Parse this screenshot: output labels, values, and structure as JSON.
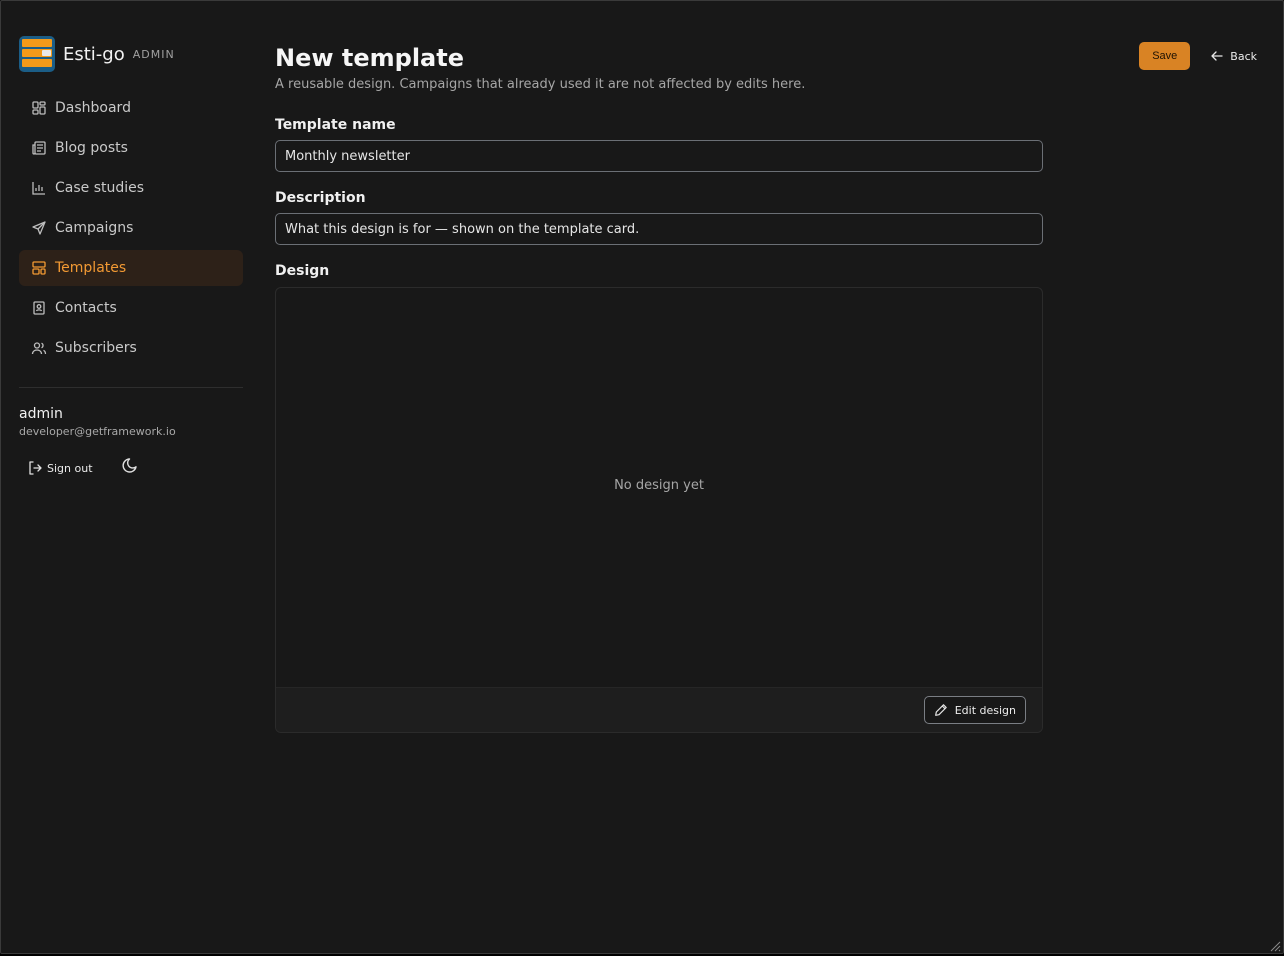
{
  "brand": {
    "name": "Esti-go",
    "tag": "ADMIN"
  },
  "nav": [
    {
      "label": "Dashboard",
      "icon": "dashboard-icon"
    },
    {
      "label": "Blog posts",
      "icon": "newspaper-icon"
    },
    {
      "label": "Case studies",
      "icon": "bar-chart-icon"
    },
    {
      "label": "Campaigns",
      "icon": "send-icon"
    },
    {
      "label": "Templates",
      "icon": "layout-template-icon",
      "active": true
    },
    {
      "label": "Contacts",
      "icon": "contact-book-icon"
    },
    {
      "label": "Subscribers",
      "icon": "users-icon"
    }
  ],
  "user": {
    "name": "admin",
    "email": "developer@getframework.io"
  },
  "sidebar_actions": {
    "sign_out": "Sign out"
  },
  "page": {
    "title": "New template",
    "subtitle": "A reusable design. Campaigns that already used it are not affected by edits here."
  },
  "header_actions": {
    "save": "Save",
    "back": "Back"
  },
  "form": {
    "name_label": "Template name",
    "name_value": "Monthly newsletter",
    "description_label": "Description",
    "description_placeholder": "What this design is for — shown on the template card.",
    "design_label": "Design",
    "design_empty": "No design yet",
    "edit_design": "Edit design"
  },
  "colors": {
    "background": "#181818",
    "accent": "#d98324",
    "active_nav_bg": "#2d2118",
    "active_nav_text": "#f39a33"
  }
}
